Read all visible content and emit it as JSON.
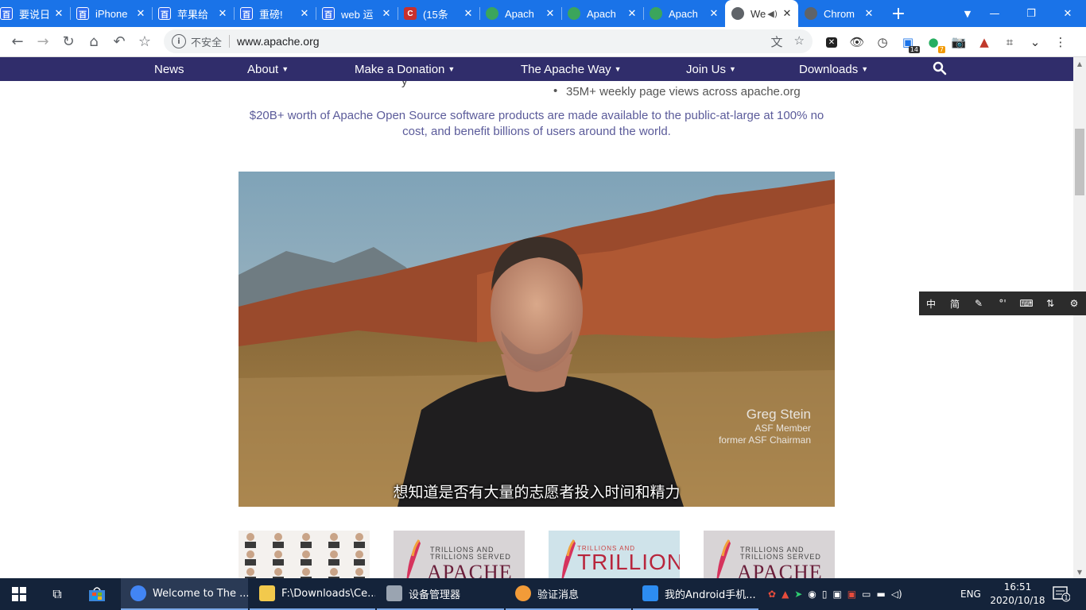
{
  "browser": {
    "tabs": [
      {
        "title": "要说日",
        "favicon": "baidu",
        "active": false
      },
      {
        "title": "iPhone",
        "favicon": "baidu",
        "active": false
      },
      {
        "title": "苹果给",
        "favicon": "baidu",
        "active": false
      },
      {
        "title": "重磅! ",
        "favicon": "baidu",
        "active": false
      },
      {
        "title": "web 运",
        "favicon": "baidu",
        "active": false
      },
      {
        "title": "(15条",
        "favicon": "csdn",
        "active": false
      },
      {
        "title": "Apach",
        "favicon": "apache",
        "active": false
      },
      {
        "title": "Apach",
        "favicon": "apache",
        "active": false
      },
      {
        "title": "Apach",
        "favicon": "apache",
        "active": false
      },
      {
        "title": "We",
        "favicon": "globe",
        "active": true
      },
      {
        "title": "Chrom",
        "favicon": "globe",
        "active": false
      }
    ],
    "omnibox": {
      "security_label": "不安全",
      "url": "www.apache.org"
    },
    "extension_badges": {
      "badge1": "14",
      "badge2": "7"
    }
  },
  "site_nav": {
    "items": [
      {
        "label": "News",
        "dropdown": false
      },
      {
        "label": "About",
        "dropdown": true
      },
      {
        "label": "Make a Donation",
        "dropdown": true
      },
      {
        "label": "The Apache Way",
        "dropdown": true
      },
      {
        "label": "Join Us",
        "dropdown": true
      },
      {
        "label": "Downloads",
        "dropdown": true
      }
    ]
  },
  "page": {
    "partial_line": "y",
    "bullet": "35M+ weekly page views across apache.org",
    "blurb": "$20B+ worth of Apache Open Source software products are made available to the public-at-large at 100% no cost, and benefit billions of users around the world.",
    "video": {
      "name": "Greg Stein",
      "role1": "ASF Member",
      "role2": "former ASF Chairman",
      "subtitle": "想知道是否有大量的志愿者投入时间和精力"
    },
    "thumbs": [
      {
        "small1": "",
        "small2": "",
        "big": ""
      },
      {
        "small1": "TRILLIONS AND",
        "small2": "TRILLIONS SERVED",
        "big": "APACHE"
      },
      {
        "small1": "TRILLIONS AND",
        "small2": "",
        "big": "TRILLIONS"
      },
      {
        "small1": "TRILLIONS AND",
        "small2": "TRILLIONS SERVED",
        "big": "APACHE"
      }
    ]
  },
  "ime_toolbar": [
    "中",
    "简",
    "✎",
    "°'",
    "⌨",
    "⇅",
    "⚙"
  ],
  "taskbar": {
    "tasks": [
      {
        "label": "Welcome to The ...",
        "active": true,
        "color": "#4285f4"
      },
      {
        "label": "F:\\Downloads\\Ce...",
        "active": false,
        "color": "#f2c94c"
      },
      {
        "label": "设备管理器",
        "active": false,
        "color": "#9aa4b1"
      },
      {
        "label": "验证消息",
        "active": false,
        "color": "#f29b38"
      },
      {
        "label": "我的Android手机...",
        "active": false,
        "color": "#2d8cf0"
      }
    ],
    "language": "ENG",
    "time": "16:51",
    "date": "2020/10/18",
    "notification_count": "1"
  },
  "colors": {
    "tabstrip": "#1a73e8",
    "site_nav": "#302d6b",
    "blurb": "#5b5b9a",
    "taskbar": "#14233a"
  }
}
